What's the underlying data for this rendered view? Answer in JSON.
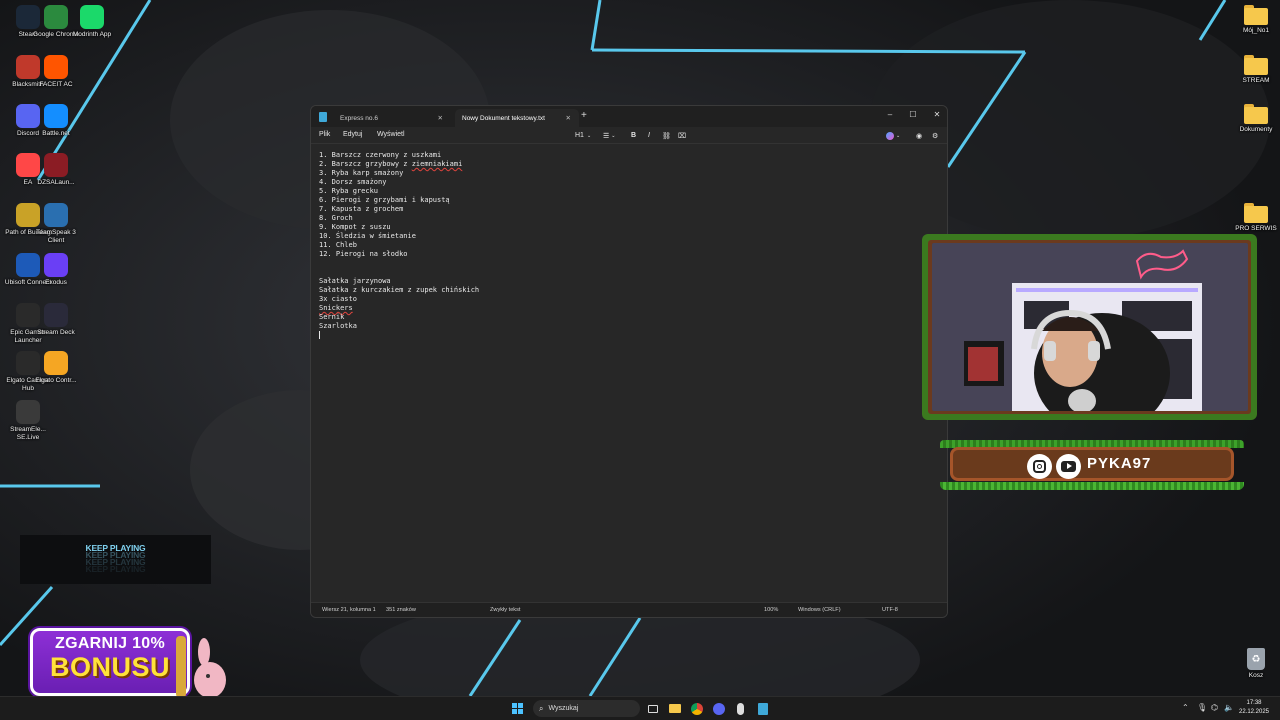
{
  "desktop": {
    "left_icons": [
      {
        "name": "steam-icon",
        "label": "Steam",
        "color": "#1b2838"
      },
      {
        "name": "google-chrome-icon",
        "label": "Google Chrome",
        "color": "#2b8a3e"
      },
      {
        "name": "modrinth-icon",
        "label": "Modrinth App",
        "color": "#1bd96a"
      },
      {
        "name": "blacksmith-icon",
        "label": "Blacksmith",
        "color": "#c0392b"
      },
      {
        "name": "faceit-icon",
        "label": "FACEIT AC",
        "color": "#ff5500"
      },
      {
        "name": "discord-icon",
        "label": "Discord",
        "color": "#5865f2"
      },
      {
        "name": "battle-net-icon",
        "label": "Battle.net",
        "color": "#148eff"
      },
      {
        "name": "ea-icon",
        "label": "EA",
        "color": "#ff4747"
      },
      {
        "name": "dzsalauncher-icon",
        "label": "DZSALaun...",
        "color": "#8b1c24"
      },
      {
        "name": "path-of-building-icon",
        "label": "Path of Building",
        "color": "#c9a227"
      },
      {
        "name": "teamspeak-icon",
        "label": "TeamSpeak 3 Client",
        "color": "#2a6fb0"
      },
      {
        "name": "ubisoft-connect-icon",
        "label": "Ubisoft Connect",
        "color": "#1d5ab8"
      },
      {
        "name": "exodus-icon",
        "label": "Exodus",
        "color": "#6a3ff5"
      },
      {
        "name": "epic-games-icon",
        "label": "Epic Games Launcher",
        "color": "#2a2a2a"
      },
      {
        "name": "stream-deck-icon",
        "label": "Stream Deck",
        "color": "#2a2a3a"
      },
      {
        "name": "elgato-camera-hub-icon",
        "label": "Elgato Camera Hub",
        "color": "#2a2a2a"
      },
      {
        "name": "elgato-control-icon",
        "label": "Elgato Contr...",
        "color": "#f5a623"
      },
      {
        "name": "streamelements-icon",
        "label": "StreamEle... SE.Live",
        "color": "#3a3a3a"
      }
    ],
    "right_icons": [
      {
        "name": "folder-icon",
        "label": "Mój_No1"
      },
      {
        "name": "folder-icon",
        "label": "STREAM"
      },
      {
        "name": "folder-icon",
        "label": "Dokumenty"
      },
      {
        "name": "folder-icon",
        "label": "PRO SERWIS"
      }
    ],
    "recycle_bin_label": "Kosz"
  },
  "widgets": {
    "keep_playing": "KEEP PLAYING",
    "bonus_line1": "ZGARNIJ 10%",
    "bonus_line2": "BONUSU",
    "streamer_handle": "PYKA97"
  },
  "notepad": {
    "tabs": [
      {
        "label": "Express no.6",
        "active": false
      },
      {
        "label": "Nowy Dokument tekstowy.txt",
        "active": true
      }
    ],
    "menu": {
      "file": "Plik",
      "edit": "Edytuj",
      "view": "Wyświetl"
    },
    "toolbar": {
      "heading": "H1",
      "bold": "B",
      "italic": "I"
    },
    "lines": [
      "1. Barszcz czerwony z uszkami",
      "2. Barszcz grzybowy z ziemniakiami",
      "3. Ryba karp smażony",
      "4. Dorsz smażony",
      "5. Ryba grecku",
      "6. Pierogi z grzybami i kapustą",
      "7. Kapusta z grochem",
      "8. Groch",
      "9. Kompot z suszu",
      "10. Śledzia w śmietanie",
      "11. Chleb",
      "12. Pierogi na słodko",
      "",
      "",
      "Sałatka jarzynowa",
      "Sałatka z kurczakiem z zupek chińskich",
      "3x ciasto",
      "Snickers",
      "Sernik",
      "Szarlotka",
      ""
    ],
    "status": {
      "position": "Wiersz 21, kolumna 1",
      "chars": "351 znaków",
      "format": "Zwykły tekst",
      "zoom": "100%",
      "line_ending": "Windows (CRLF)",
      "encoding": "UTF-8"
    }
  },
  "taskbar": {
    "search_placeholder": "Wyszukaj",
    "time": "17:38",
    "date": "22.12.2025"
  }
}
